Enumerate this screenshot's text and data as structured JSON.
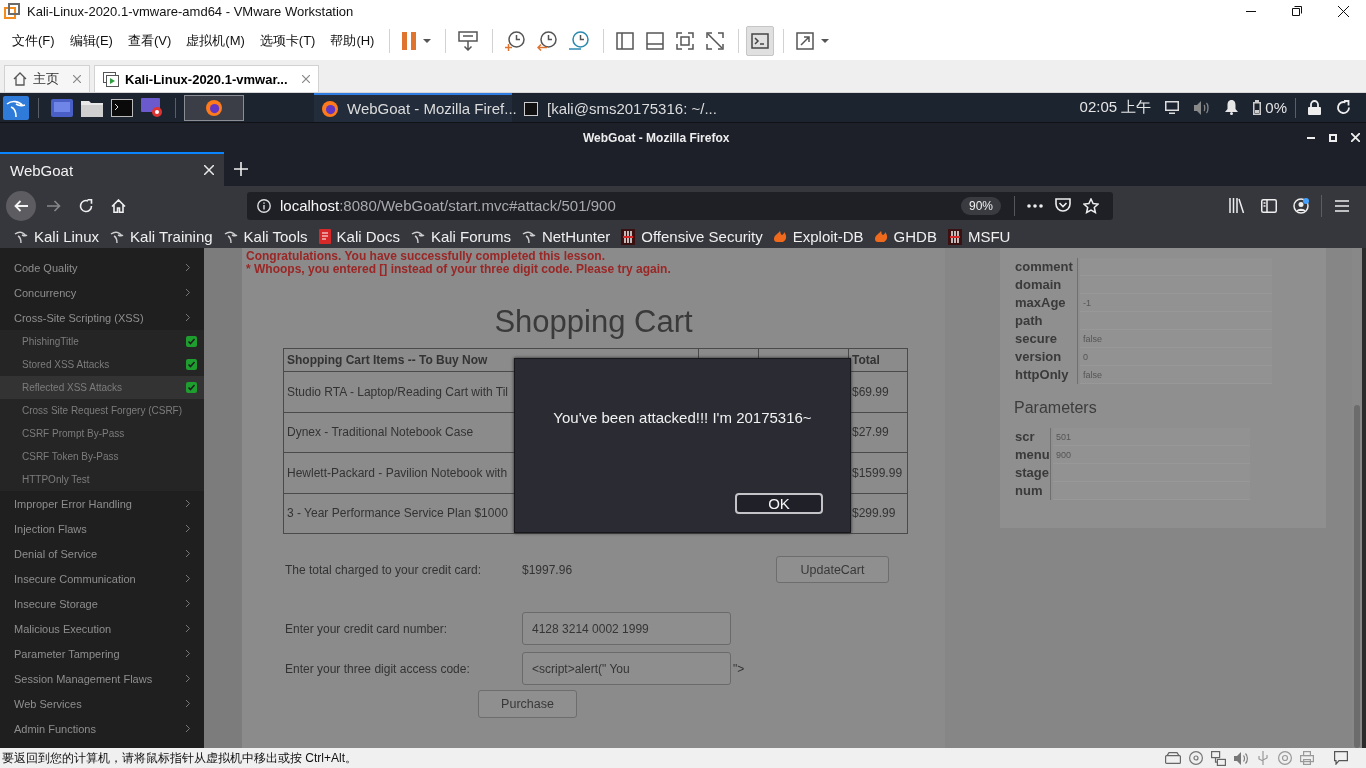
{
  "vmware": {
    "title": "Kali-Linux-2020.1-vmware-amd64 - VMware Workstation",
    "menu": [
      "文件(F)",
      "编辑(E)",
      "查看(V)",
      "虚拟机(M)",
      "选项卡(T)",
      "帮助(H)"
    ],
    "toolbar": [
      [
        {
          "kind": "pause",
          "dropdown": true,
          "selected": false
        }
      ],
      [
        {
          "kind": "send-keys",
          "selected": false
        }
      ],
      [
        {
          "kind": "snapshot",
          "selected": false
        },
        {
          "kind": "revert",
          "selected": false
        },
        {
          "kind": "snapshot-manager",
          "selected": false
        }
      ],
      [
        {
          "kind": "library",
          "selected": false
        },
        {
          "kind": "thumbnail",
          "selected": false
        },
        {
          "kind": "fullscreen",
          "selected": false
        },
        {
          "kind": "unity",
          "selected": false
        }
      ],
      [
        {
          "kind": "console",
          "selected": true
        }
      ],
      [
        {
          "kind": "stretch",
          "dropdown": true,
          "selected": false
        }
      ]
    ],
    "tabs": [
      {
        "kind": "home",
        "label": "主页",
        "selected": false
      },
      {
        "kind": "vm",
        "label": "Kali-Linux-2020.1-vmwar...",
        "selected": true
      }
    ],
    "status": "要返回到您的计算机，请将鼠标指针从虚拟机中移出或按 Ctrl+Alt。"
  },
  "kali_panel": {
    "launchers": [
      [
        {
          "kind": "workspace",
          "selected": false
        },
        {
          "kind": "files",
          "selected": false
        },
        {
          "kind": "terminal",
          "selected": false
        },
        {
          "kind": "recorder",
          "selected": false
        }
      ],
      [
        {
          "kind": "firefox",
          "selected": true
        }
      ]
    ],
    "tasks": [
      {
        "kind": "firefox",
        "label": "WebGoat - Mozilla Firef...",
        "selected": true
      },
      {
        "kind": "terminal",
        "label": "[kali@sms20175316: ~/...",
        "selected": false
      }
    ],
    "clock": "02:05 上午",
    "battery": "0%"
  },
  "firefox": {
    "title": "WebGoat - Mozilla Firefox",
    "tabs": [
      {
        "label": "WebGoat",
        "selected": true
      }
    ],
    "forward_disabled": true,
    "url_host": "localhost",
    "url_path": ":8080/WebGoat/start.mvc#attack/501/900",
    "zoom": "90%",
    "bookmarks": [
      {
        "kind": "kali",
        "label": "Kali Linux"
      },
      {
        "kind": "kali",
        "label": "Kali Training"
      },
      {
        "kind": "kali",
        "label": "Kali Tools"
      },
      {
        "kind": "docs",
        "label": "Kali Docs"
      },
      {
        "kind": "kali",
        "label": "Kali Forums"
      },
      {
        "kind": "kali",
        "label": "NetHunter"
      },
      {
        "kind": "offsec",
        "label": "Offensive Security"
      },
      {
        "kind": "flame",
        "label": "Exploit-DB"
      },
      {
        "kind": "flame",
        "label": "GHDB"
      },
      {
        "kind": "offsec",
        "label": "MSFU"
      }
    ]
  },
  "sidebar": [
    {
      "label": "Code Quality"
    },
    {
      "label": "Concurrency"
    },
    {
      "label": "Cross-Site Scripting (XSS)",
      "children": [
        {
          "label": "PhishingTitle",
          "done": true,
          "selected": false
        },
        {
          "label": "Stored XSS Attacks",
          "done": true,
          "selected": false
        },
        {
          "label": "Reflected XSS Attacks",
          "done": true,
          "selected": true
        },
        {
          "label": "Cross Site Request Forgery (CSRF)",
          "done": false,
          "selected": false
        },
        {
          "label": "CSRF Prompt By-Pass",
          "done": false,
          "selected": false
        },
        {
          "label": "CSRF Token By-Pass",
          "done": false,
          "selected": false
        },
        {
          "label": "HTTPOnly Test",
          "done": false,
          "selected": false
        }
      ]
    },
    {
      "label": "Improper Error Handling"
    },
    {
      "label": "Injection Flaws"
    },
    {
      "label": "Denial of Service"
    },
    {
      "label": "Insecure Communication"
    },
    {
      "label": "Insecure Storage"
    },
    {
      "label": "Malicious Execution"
    },
    {
      "label": "Parameter Tampering"
    },
    {
      "label": "Session Management Flaws"
    },
    {
      "label": "Web Services"
    },
    {
      "label": "Admin Functions"
    }
  ],
  "lesson": {
    "messages": [
      "Congratulations. You have successfully completed this lesson.",
      "* Whoops, you entered [] instead of your three digit code. Please try again."
    ],
    "title": "Shopping Cart",
    "table": {
      "header": {
        "column_1": "Shopping Cart Items -- To Buy Now",
        "column_4": "Total"
      },
      "rows": [
        {
          "column_1": "Studio RTA - Laptop/Reading Cart with Til",
          "column_4": "$69.99"
        },
        {
          "column_1": "Dynex - Traditional Notebook Case",
          "column_4": "$27.99"
        },
        {
          "column_1": "Hewlett-Packard - Pavilion Notebook with",
          "column_4": "$1599.99"
        },
        {
          "column_1": "3 - Year Performance Service Plan $1000",
          "column_4": "$299.99"
        }
      ]
    },
    "total_label": "The total charged to your credit card:",
    "total_value": "$1997.96",
    "update_button": "UpdateCart",
    "fields": [
      {
        "label": "Enter your credit card number:",
        "value": "4128 3214 0002 1999"
      },
      {
        "label": "Enter your three digit access code:",
        "value": "<script>alert(\" You",
        "suffix": "\">"
      }
    ],
    "purchase_button": "Purchase"
  },
  "dialog": {
    "message": "You've been attacked!!! I'm 20175316~",
    "button": "OK"
  },
  "info": {
    "cookie": [
      {
        "name": "comment"
      },
      {
        "name": "domain"
      },
      {
        "name": "maxAge",
        "value": "-1"
      },
      {
        "name": "path"
      },
      {
        "name": "secure",
        "value": "false"
      },
      {
        "name": "version",
        "value": "0"
      },
      {
        "name": "httpOnly",
        "value": "false"
      }
    ],
    "parameters_title": "Parameters",
    "parameters": [
      {
        "name": "scr",
        "value": "501"
      },
      {
        "name": "menu",
        "value": "900"
      },
      {
        "name": "stage"
      },
      {
        "name": "num"
      }
    ]
  }
}
